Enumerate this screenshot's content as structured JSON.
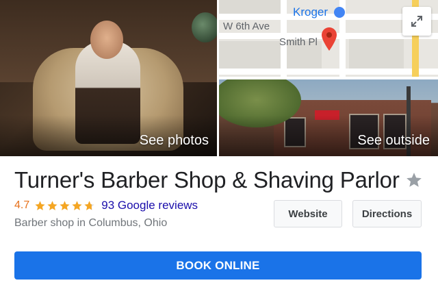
{
  "gallery": {
    "photos_label": "See photos",
    "outside_label": "See outside"
  },
  "map": {
    "store_label": "Kroger",
    "street_1": "W 6th Ave",
    "street_2": "Smith Pl",
    "expand_icon": "expand-icon",
    "pin_icon": "map-pin-icon",
    "pin_color": "#ea4335"
  },
  "business": {
    "name": "Turner's Barber Shop & Shaving Parlor",
    "rating": "4.7",
    "rating_stars": 4.7,
    "reviews_label": "93 Google reviews",
    "category": "Barber shop in Columbus, Ohio",
    "save_icon": "star-icon"
  },
  "actions": {
    "website_label": "Website",
    "directions_label": "Directions",
    "book_label": "BOOK ONLINE"
  },
  "colors": {
    "accent": "#1a73e8",
    "rating": "#e7711b",
    "link": "#1a0dab",
    "star": "#f5a623"
  }
}
